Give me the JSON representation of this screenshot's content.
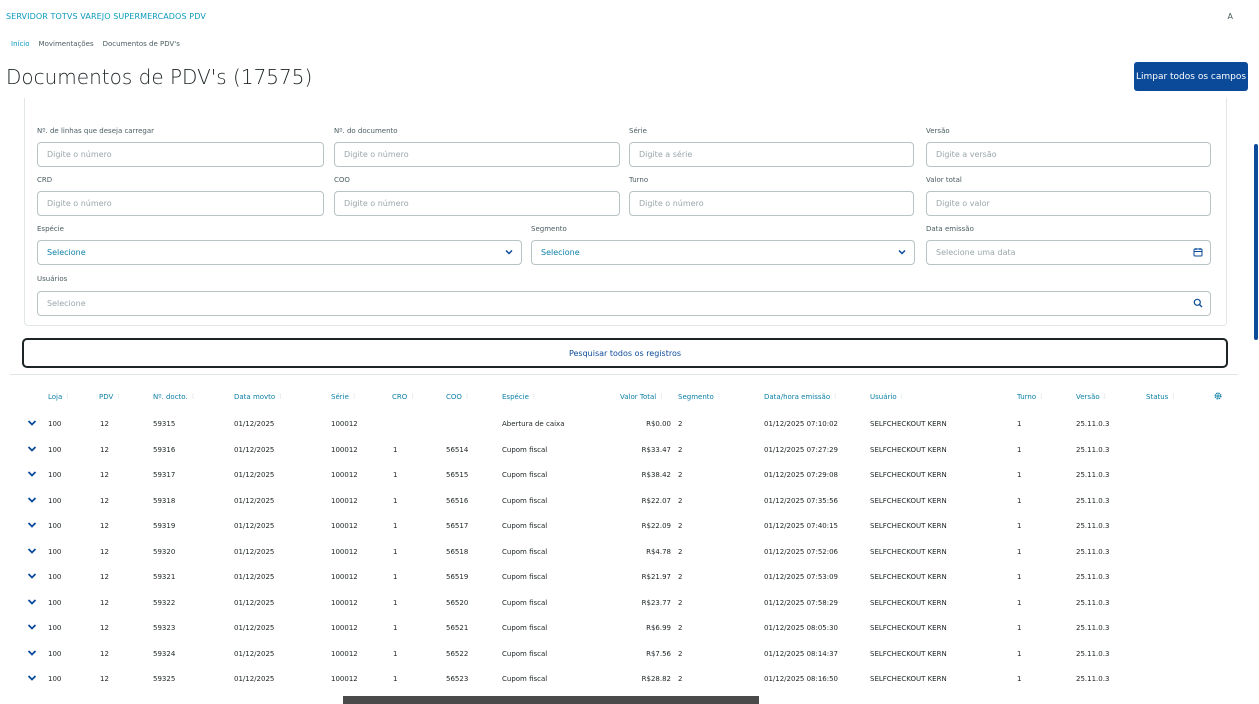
{
  "app": {
    "title": "SERVIDOR TOTVS VAREJO SUPERMERCADOS PDV",
    "user_initial": "A"
  },
  "breadcrumb": [
    "Início",
    "Movimentações",
    "Documentos de PDV's"
  ],
  "page": {
    "title": "Documentos de PDV's (17575)",
    "clear_button": "Limpar todos os campos"
  },
  "filters": {
    "lines": {
      "label": "Nº. de linhas que deseja carregar",
      "placeholder": "Digite o número"
    },
    "doc_number": {
      "label": "Nº. do documento",
      "placeholder": "Digite o número"
    },
    "serie": {
      "label": "Série",
      "placeholder": "Digite a série"
    },
    "versao": {
      "label": "Versão",
      "placeholder": "Digite a versão"
    },
    "crd": {
      "label": "CRD",
      "placeholder": "Digite o número"
    },
    "coo": {
      "label": "COO",
      "placeholder": "Digite o número"
    },
    "turno": {
      "label": "Turno",
      "placeholder": "Digite o número"
    },
    "valor_total": {
      "label": "Valor total",
      "placeholder": "Digite o valor"
    },
    "especie": {
      "label": "Espécie",
      "placeholder": "Selecione"
    },
    "segmento": {
      "label": "Segmento",
      "placeholder": "Selecione"
    },
    "data_emissao": {
      "label": "Data emissão",
      "placeholder": "Selecione uma data"
    },
    "usuarios": {
      "label": "Usuários",
      "placeholder": "Selecione"
    },
    "search_all": "Pesquisar todos os registros"
  },
  "table": {
    "headers": [
      "Loja",
      "PDV",
      "Nº. docto.",
      "Data movto",
      "Série",
      "CRO",
      "COO",
      "Espécie",
      "Valor Total",
      "Segmento",
      "Data/hora emissão",
      "Usuário",
      "Turno",
      "Versão",
      "Status"
    ],
    "rows": [
      [
        "100",
        "12",
        "59315",
        "01/12/2025",
        "100012",
        "",
        "",
        "Abertura de caixa",
        "R$0.00",
        "2",
        "01/12/2025 07:10:02",
        "SELFCHECKOUT KERN",
        "1",
        "25.11.0.3"
      ],
      [
        "100",
        "12",
        "59316",
        "01/12/2025",
        "100012",
        "1",
        "56514",
        "Cupom fiscal",
        "R$33.47",
        "2",
        "01/12/2025 07:27:29",
        "SELFCHECKOUT KERN",
        "1",
        "25.11.0.3"
      ],
      [
        "100",
        "12",
        "59317",
        "01/12/2025",
        "100012",
        "1",
        "56515",
        "Cupom fiscal",
        "R$38.42",
        "2",
        "01/12/2025 07:29:08",
        "SELFCHECKOUT KERN",
        "1",
        "25.11.0.3"
      ],
      [
        "100",
        "12",
        "59318",
        "01/12/2025",
        "100012",
        "1",
        "56516",
        "Cupom fiscal",
        "R$22.07",
        "2",
        "01/12/2025 07:35:56",
        "SELFCHECKOUT KERN",
        "1",
        "25.11.0.3"
      ],
      [
        "100",
        "12",
        "59319",
        "01/12/2025",
        "100012",
        "1",
        "56517",
        "Cupom fiscal",
        "R$22.09",
        "2",
        "01/12/2025 07:40:15",
        "SELFCHECKOUT KERN",
        "1",
        "25.11.0.3"
      ],
      [
        "100",
        "12",
        "59320",
        "01/12/2025",
        "100012",
        "1",
        "56518",
        "Cupom fiscal",
        "R$4.78",
        "2",
        "01/12/2025 07:52:06",
        "SELFCHECKOUT KERN",
        "1",
        "25.11.0.3"
      ],
      [
        "100",
        "12",
        "59321",
        "01/12/2025",
        "100012",
        "1",
        "56519",
        "Cupom fiscal",
        "R$21.97",
        "2",
        "01/12/2025 07:53:09",
        "SELFCHECKOUT KERN",
        "1",
        "25.11.0.3"
      ],
      [
        "100",
        "12",
        "59322",
        "01/12/2025",
        "100012",
        "1",
        "56520",
        "Cupom fiscal",
        "R$23.77",
        "2",
        "01/12/2025 07:58:29",
        "SELFCHECKOUT KERN",
        "1",
        "25.11.0.3"
      ],
      [
        "100",
        "12",
        "59323",
        "01/12/2025",
        "100012",
        "1",
        "56521",
        "Cupom fiscal",
        "R$6.99",
        "2",
        "01/12/2025 08:05:30",
        "SELFCHECKOUT KERN",
        "1",
        "25.11.0.3"
      ],
      [
        "100",
        "12",
        "59324",
        "01/12/2025",
        "100012",
        "1",
        "56522",
        "Cupom fiscal",
        "R$7.56",
        "2",
        "01/12/2025 08:14:37",
        "SELFCHECKOUT KERN",
        "1",
        "25.11.0.3"
      ],
      [
        "100",
        "12",
        "59325",
        "01/12/2025",
        "100012",
        "1",
        "56523",
        "Cupom fiscal",
        "R$28.82",
        "2",
        "01/12/2025 08:16:50",
        "SELFCHECKOUT KERN",
        "1",
        "25.11.0.3"
      ]
    ]
  },
  "colors": {
    "primary": "#0b4a99",
    "link": "#0c9abe",
    "header_text": "#0b7fa6"
  },
  "icons": {
    "expand": "chevron-down-icon",
    "calendar": "calendar-icon",
    "search": "search-icon",
    "columns": "gear-icon"
  }
}
